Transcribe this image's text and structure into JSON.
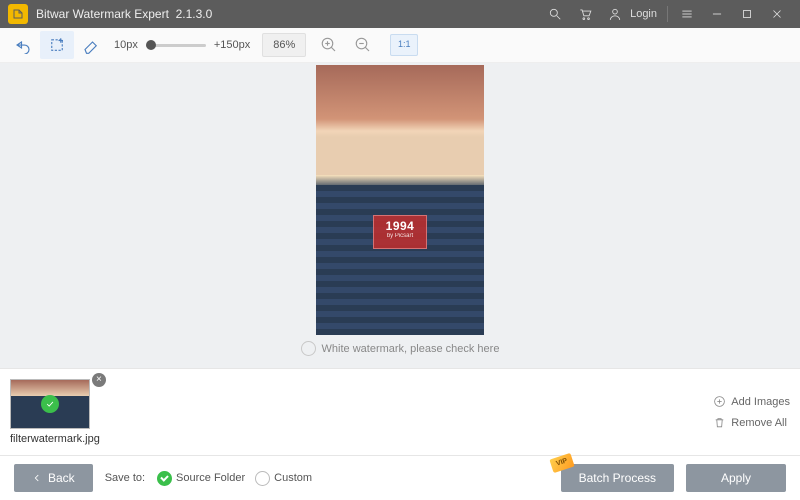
{
  "titlebar": {
    "app_name": "Bitwar Watermark Expert",
    "version": "2.1.3.0",
    "login": "Login"
  },
  "toolbar": {
    "size_min": "10px",
    "size_max": "+150px",
    "zoom": "86%",
    "ratio": "1:1"
  },
  "canvas": {
    "watermark_year": "1994",
    "watermark_by": "by Picsart",
    "check_label": "White watermark, please check here"
  },
  "thumbs": {
    "items": [
      {
        "filename": "filterwatermark.jpg"
      }
    ],
    "add": "Add Images",
    "remove": "Remove All"
  },
  "footer": {
    "back": "Back",
    "save_to": "Save to:",
    "opt_source": "Source Folder",
    "opt_custom": "Custom",
    "batch": "Batch Process",
    "vip": "VIP",
    "apply": "Apply"
  }
}
